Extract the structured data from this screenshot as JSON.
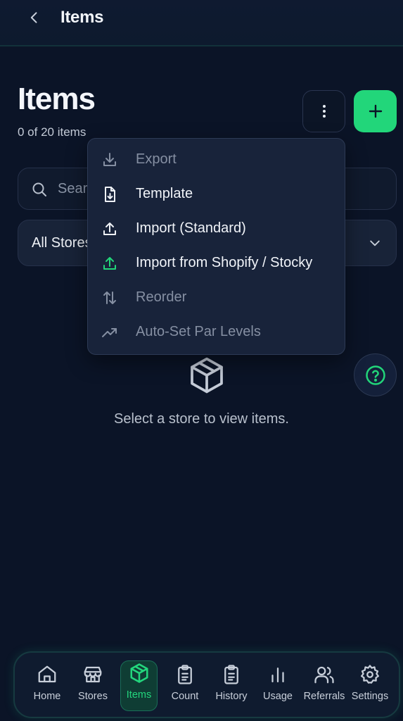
{
  "header": {
    "title": "Items"
  },
  "page": {
    "title": "Items",
    "count_text": "0 of 20 items"
  },
  "search": {
    "placeholder": "Search"
  },
  "store_select": {
    "value": "All Stores"
  },
  "menu": {
    "items": [
      {
        "label": "Export",
        "icon": "download-icon",
        "enabled": false
      },
      {
        "label": "Template",
        "icon": "file-download-icon",
        "enabled": true
      },
      {
        "label": "Import (Standard)",
        "icon": "upload-icon",
        "enabled": true
      },
      {
        "label": "Import from Shopify / Stocky",
        "icon": "upload-icon",
        "enabled": true
      },
      {
        "label": "Reorder",
        "icon": "sort-arrows-icon",
        "enabled": false
      },
      {
        "label": "Auto-Set Par Levels",
        "icon": "trending-up-icon",
        "enabled": false
      }
    ]
  },
  "empty_state": {
    "message": "Select a store to view items.",
    "icon": "package-icon"
  },
  "nav": {
    "items": [
      {
        "label": "Home",
        "icon": "home-icon",
        "active": false
      },
      {
        "label": "Stores",
        "icon": "store-icon",
        "active": false
      },
      {
        "label": "Items",
        "icon": "package-icon",
        "active": true
      },
      {
        "label": "Count",
        "icon": "clipboard-icon",
        "active": false
      },
      {
        "label": "History",
        "icon": "clipboard-list-icon",
        "active": false
      },
      {
        "label": "Usage",
        "icon": "bar-chart-icon",
        "active": false
      },
      {
        "label": "Referrals",
        "icon": "users-icon",
        "active": false
      },
      {
        "label": "Settings",
        "icon": "gear-icon",
        "active": false
      }
    ]
  },
  "colors": {
    "accent": "#22d67a",
    "background": "#0b1427",
    "surface": "#18233a",
    "muted_text": "#858fa2"
  }
}
